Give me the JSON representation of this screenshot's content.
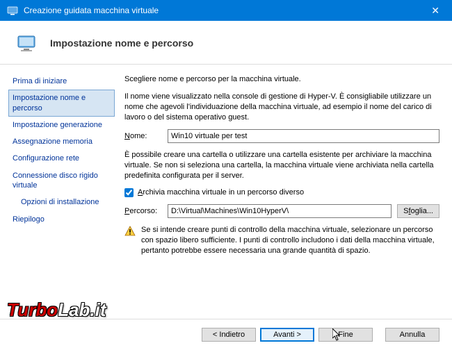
{
  "titlebar": {
    "title": "Creazione guidata macchina virtuale",
    "close": "✕"
  },
  "header": {
    "title": "Impostazione nome e percorso"
  },
  "sidebar": {
    "items": [
      {
        "label": "Prima di iniziare"
      },
      {
        "label": "Impostazione nome e percorso"
      },
      {
        "label": "Impostazione generazione"
      },
      {
        "label": "Assegnazione memoria"
      },
      {
        "label": "Configurazione rete"
      },
      {
        "label": "Connessione disco rigido virtuale"
      },
      {
        "label": "Opzioni di installazione"
      },
      {
        "label": "Riepilogo"
      }
    ]
  },
  "content": {
    "intro": "Scegliere nome e percorso per la macchina virtuale.",
    "desc1": "Il nome viene visualizzato nella console di gestione di Hyper-V. È consigliabile utilizzare un nome che agevoli l'individuazione della macchina virtuale, ad esempio il nome del carico di lavoro o del sistema operativo guest.",
    "name_label": "Nome:",
    "name_value": "Win10 virtuale per test",
    "desc2": "È possibile creare una cartella o utilizzare una cartella esistente per archiviare la macchina virtuale. Se non si seleziona una cartella, la macchina virtuale viene archiviata nella cartella predefinita configurata per il server.",
    "checkbox_label": "Archivia macchina virtuale in un percorso diverso",
    "checkbox_prefix": "A",
    "checkbox_suffix": "rchivia macchina virtuale in un percorso diverso",
    "path_label": "Percorso:",
    "path_value": "D:\\Virtual\\Machines\\Win10HyperV\\",
    "browse_label": "Sfoglia...",
    "warning_text": "Se si intende creare punti di controllo della macchina virtuale, selezionare un percorso con spazio libero sufficiente. I punti di controllo includono i dati della macchina virtuale, pertanto potrebbe essere necessaria una grande quantità di spazio."
  },
  "footer": {
    "back": "< Indietro",
    "next": "Avanti >",
    "finish": "Fine",
    "cancel": "Annulla"
  },
  "watermark": {
    "part1": "Turbo",
    "part2": "Lab.it"
  }
}
